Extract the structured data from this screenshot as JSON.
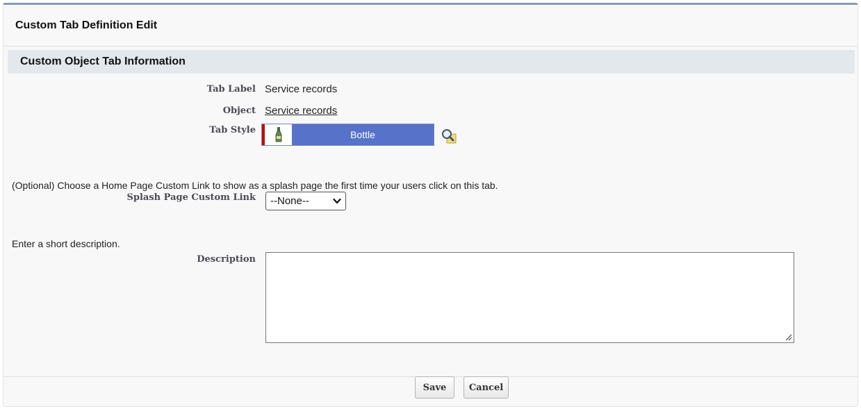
{
  "page": {
    "title": "Custom Tab Definition Edit"
  },
  "section": {
    "title": "Custom Object Tab Information"
  },
  "fields": {
    "tab_label": {
      "label": "Tab Label",
      "value": "Service records"
    },
    "object": {
      "label": "Object",
      "value": "Service records"
    },
    "tab_style": {
      "label": "Tab Style",
      "value": "Bottle",
      "icon": "bottle-icon",
      "color": "#5773c9",
      "accent": "#c00c0c"
    }
  },
  "splash": {
    "hint": "(Optional) Choose a Home Page Custom Link to show as a splash page the first time your users click on this tab.",
    "label": "Splash Page Custom Link",
    "selected": "--None--"
  },
  "description": {
    "hint": "Enter a short description.",
    "label": "Description",
    "value": ""
  },
  "buttons": {
    "save": "Save",
    "cancel": "Cancel"
  },
  "icons": {
    "lookup": "magnifier-lookup-icon",
    "dropdown": "chevron-down-icon"
  }
}
